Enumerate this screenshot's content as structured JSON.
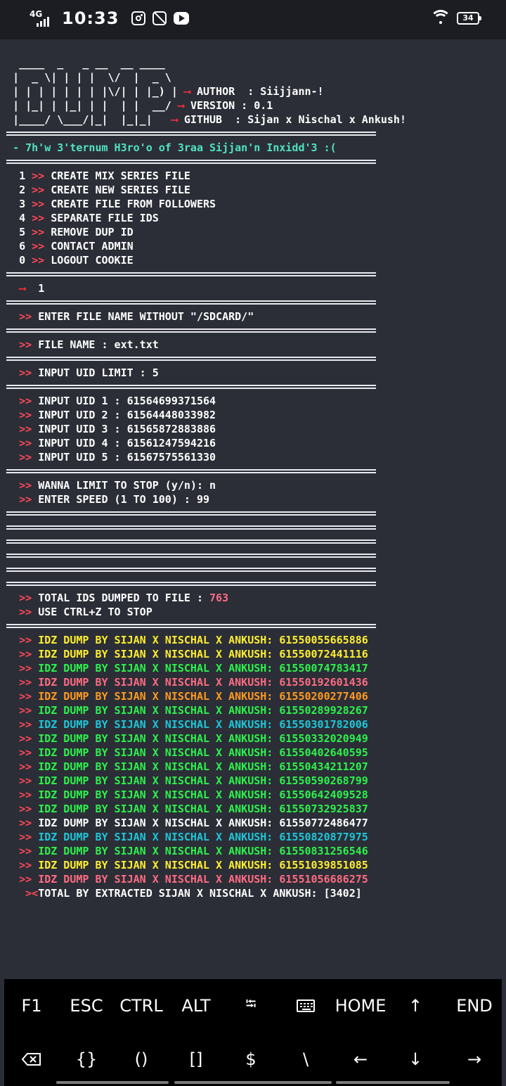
{
  "statusbar": {
    "network": "4G",
    "time": "10:33",
    "battery": "34"
  },
  "banner": {
    "art": [
      " ____  _   _ __  __ ____",
      "|  _ \\| | | |  \\/  |  _ \\",
      "| | | | | | | |\\/| | |_) |",
      "| |_| | |_| | |  | |  __/",
      "|____/ \\___/|_|  |_|_|"
    ],
    "author_label": "AUTHOR  : Siijjann-!",
    "version_label": "VERSION : 0.1",
    "github_label": "GITHUB  : Sijan x Nischal x Ankush!",
    "arrow": "⟶"
  },
  "tagline": "- 7h'w 3'ternum H3ro'o of 3raa Sijjan'n Inxidd'3 :(",
  "prompt_symbol": ">>",
  "menu": [
    {
      "num": "1",
      "label": "CREATE MIX SERIES FILE"
    },
    {
      "num": "2",
      "label": "CREATE NEW SERIES FILE"
    },
    {
      "num": "3",
      "label": "CREATE FILE FROM FOLLOWERS"
    },
    {
      "num": "4",
      "label": "SEPARATE FILE IDS"
    },
    {
      "num": "5",
      "label": "REMOVE DUP ID"
    },
    {
      "num": "6",
      "label": "CONTACT ADMIN"
    },
    {
      "num": "0",
      "label": "LOGOUT COOKIE"
    }
  ],
  "choice": {
    "arrow": "⟶",
    "value": "1"
  },
  "file_prompt": "ENTER FILE NAME WITHOUT \"/SDCARD/\"",
  "file_name": "FILE NAME : ext.txt",
  "uid_limit": "INPUT UID LIMIT : 5",
  "uids": [
    "INPUT UID 1 : 61564699371564",
    "INPUT UID 2 : 61564448033982",
    "INPUT UID 3 : 61565872883886",
    "INPUT UID 4 : 61561247594216",
    "INPUT UID 5 : 61567575561330"
  ],
  "options": [
    "WANNA LIMIT TO STOP (y/n): n",
    "ENTER SPEED (1 TO 100) : 99"
  ],
  "total": {
    "label": "TOTAL IDS DUMPED TO FILE : ",
    "value": "763"
  },
  "stop_hint": "USE CTRL+Z TO STOP",
  "dump": {
    "prefix": "IDZ DUMP BY SIJAN X NISCHAL X ANKUSH: ",
    "colors": {
      "yellow": "#ffee2e",
      "green": "#2cf24b",
      "pink": "#ff6b81",
      "orange": "#ff9a1f",
      "cyan": "#1ec6d8",
      "white": "#ffffff"
    },
    "rows": [
      {
        "id": "61550055665886",
        "color": "yellow"
      },
      {
        "id": "61550072441116",
        "color": "yellow"
      },
      {
        "id": "61550074783417",
        "color": "green"
      },
      {
        "id": "61550192601436",
        "color": "pink"
      },
      {
        "id": "61550200277406",
        "color": "orange"
      },
      {
        "id": "61550289928267",
        "color": "green"
      },
      {
        "id": "61550301782006",
        "color": "cyan"
      },
      {
        "id": "61550332020949",
        "color": "green"
      },
      {
        "id": "61550402640595",
        "color": "green"
      },
      {
        "id": "61550434211207",
        "color": "green"
      },
      {
        "id": "61550590268799",
        "color": "green"
      },
      {
        "id": "61550642409528",
        "color": "green"
      },
      {
        "id": "61550732925837",
        "color": "green"
      },
      {
        "id": "61550772486477",
        "color": "white"
      },
      {
        "id": "61550820877975",
        "color": "cyan"
      },
      {
        "id": "61550831256546",
        "color": "green"
      },
      {
        "id": "61551039851085",
        "color": "yellow"
      },
      {
        "id": "61551056686275",
        "color": "pink"
      }
    ]
  },
  "extracted": {
    "prefix": "><",
    "label": "TOTAL BY EXTRACTED SIJAN X NISCHAL X ANKUSH: [3402]"
  },
  "extra_keys": {
    "row1": [
      "F1",
      "ESC",
      "CTRL",
      "ALT",
      "⭾",
      "keyboard-icon",
      "HOME",
      "↑",
      "END"
    ],
    "row2": [
      "backspace-icon",
      "{}",
      "()",
      "[]",
      "$",
      "\\",
      "←",
      "↓",
      "→"
    ]
  }
}
